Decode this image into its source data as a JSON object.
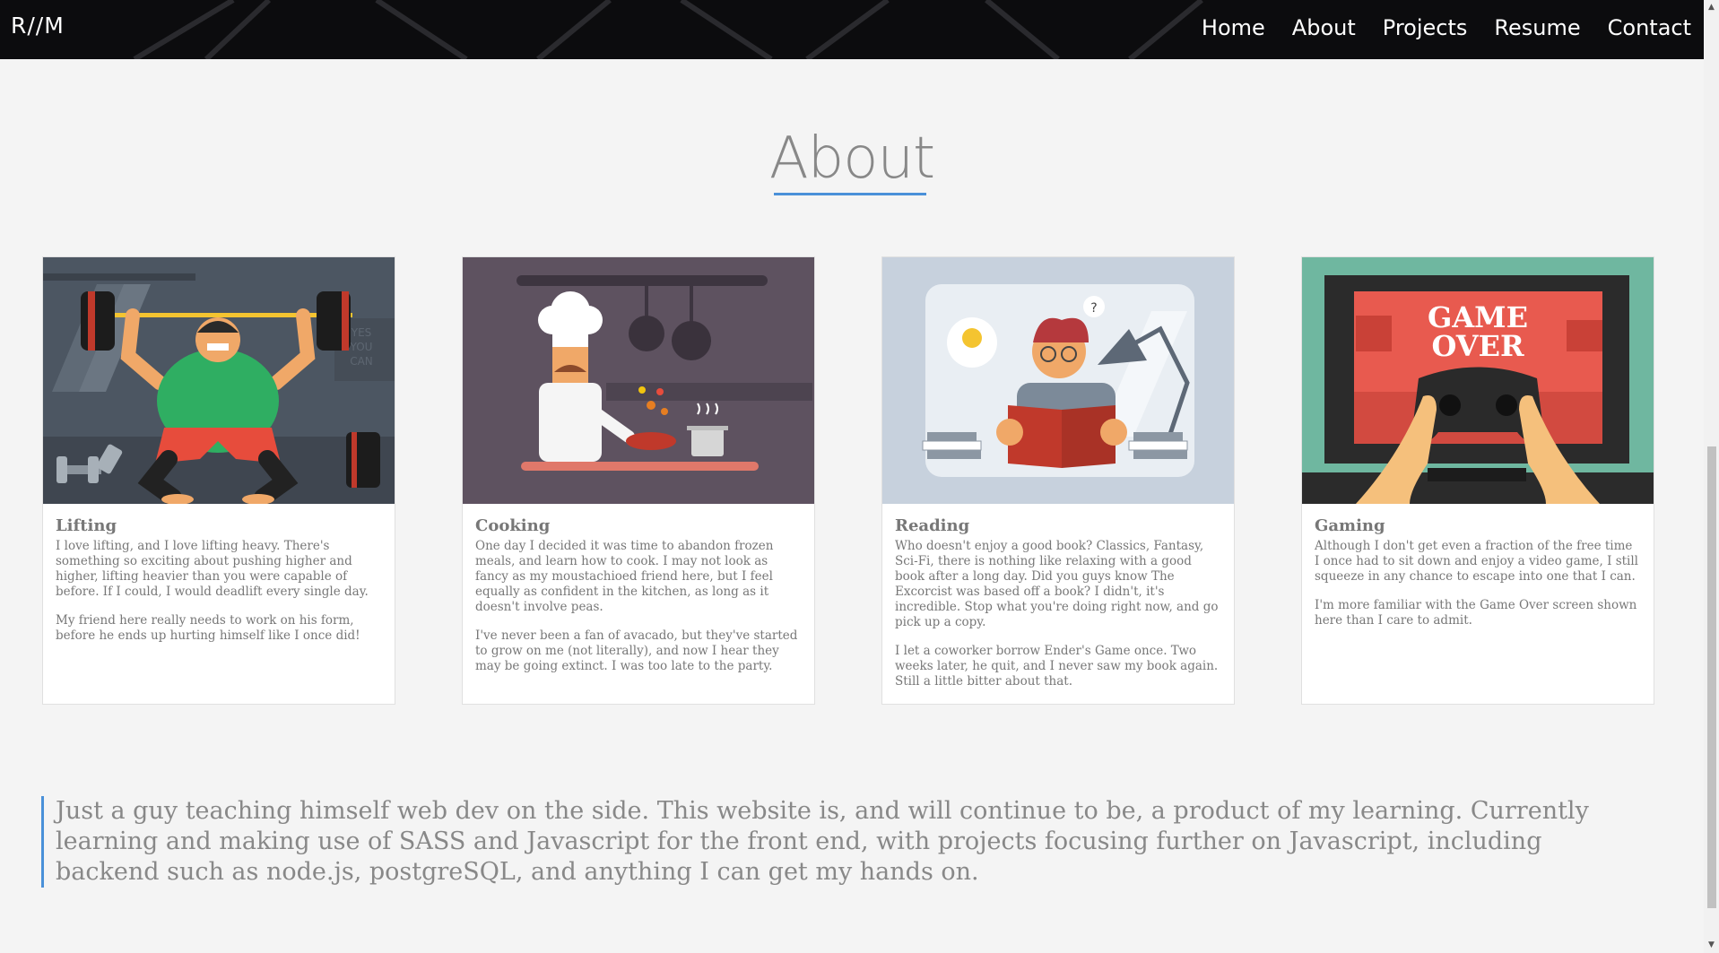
{
  "nav": {
    "logo": "R//M",
    "links": [
      "Home",
      "About",
      "Projects",
      "Resume",
      "Contact"
    ]
  },
  "about": {
    "title": "About"
  },
  "cards": [
    {
      "title": "Lifting",
      "paragraphs": [
        "I love lifting, and I love lifting heavy. There's something so exciting about pushing higher and higher, lifting heavier than you were capable of before. If I could, I would deadlift every single day.",
        "My friend here really needs to work on his form, before he ends up hurting himself like I once did!"
      ],
      "image_text": [
        "YES",
        "YOU",
        "CAN"
      ]
    },
    {
      "title": "Cooking",
      "paragraphs": [
        "One day I decided it was time to abandon frozen meals, and learn how to cook. I may not look as fancy as my moustachioed friend here, but I feel equally as confident in the kitchen, as long as it doesn't involve peas.",
        "I've never been a fan of avacado, but they've started to grow on me (not literally), and now I hear they may be going extinct. I was too late to the party."
      ]
    },
    {
      "title": "Reading",
      "paragraphs": [
        "Who doesn't enjoy a good book? Classics, Fantasy, Sci-Fi, there is nothing like relaxing with a good book after a long day. Did you guys know The Excorcist was based off a book? I didn't, it's incredible. Stop what you're doing right now, and go pick up a copy.",
        "I let a coworker borrow Ender's Game once. Two weeks later, he quit, and I never saw my book again. Still a little bitter about that."
      ],
      "image_text": [
        "?"
      ]
    },
    {
      "title": "Gaming",
      "paragraphs": [
        "Although I don't get even a fraction of the free time I once had to sit down and enjoy a video game, I still squeeze in any chance to escape into one that I can.",
        "I'm more familiar with the Game Over screen shown here than I care to admit."
      ],
      "image_text": [
        "GAME",
        "OVER"
      ]
    }
  ],
  "quote": "Just a guy teaching himself web dev on the side. This website is, and will continue to be, a product of my learning. Currently learning and making use of SASS and Javascript for the front end, with projects focusing further on Javascript, including backend such as node.js, postgreSQL, and anything I can get my hands on.",
  "colors": {
    "accent": "#4a90d9",
    "nav_bg": "#0c0c0e",
    "page_bg": "#f4f4f4"
  }
}
